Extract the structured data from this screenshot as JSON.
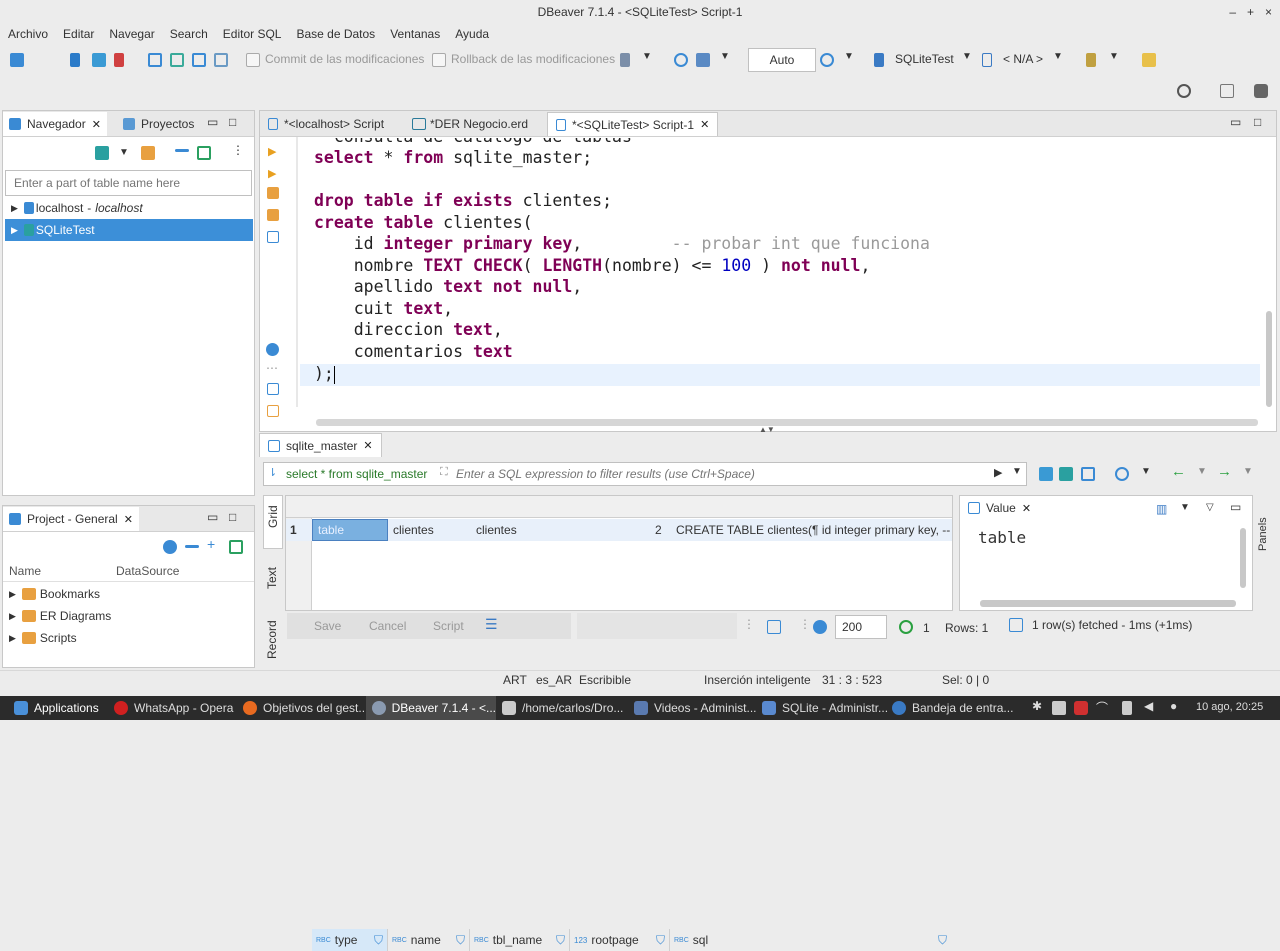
{
  "window": {
    "title": "DBeaver 7.1.4 - <SQLiteTest> Script-1"
  },
  "menu": [
    "Archivo",
    "Editar",
    "Navegar",
    "Search",
    "Editor SQL",
    "Base de Datos",
    "Ventanas",
    "Ayuda"
  ],
  "toolbar": {
    "commit_label": "Commit de las modificaciones",
    "rollback_label": "Rollback de las modificaciones",
    "mode_value": "Auto",
    "datasource": "SQLiteTest",
    "schema": "< N/A >"
  },
  "navigator": {
    "tab_label": "Navegador",
    "projects_tab": "Proyectos",
    "filter_placeholder": "Enter a part of table name here",
    "items": [
      {
        "label": "localhost",
        "sublabel": "localhost"
      },
      {
        "label": "SQLiteTest"
      }
    ]
  },
  "project": {
    "tab_label": "Project - General",
    "col_name": "Name",
    "col_datasource": "DataSource",
    "items": [
      "Bookmarks",
      "ER Diagrams",
      "Scripts"
    ]
  },
  "editor_tabs": [
    "*<localhost> Script",
    "*DER Negocio.erd",
    "*<SQLiteTest> Script-1"
  ],
  "code": {
    "line0": "  consulta de catalogo de tablas",
    "line1_kw1": "select",
    "line1_rest": " * ",
    "line1_kw2": "from",
    "line1_tail": " sqlite_master;",
    "line3_kw": "drop table if exists",
    "line3_tail": " clientes;",
    "line4_kw": "create table",
    "line4_tail": " clientes(",
    "line5_a": "    id ",
    "line5_kw": "integer primary key",
    "line5_b": ",         ",
    "line5_cmt": "-- probar int que funciona",
    "line6_a": "    nombre ",
    "line6_kw": "TEXT CHECK",
    "line6_b": "( ",
    "line6_kw2": "LENGTH",
    "line6_c": "(nombre) <= ",
    "line6_num": "100",
    "line6_d": " ) ",
    "line6_kw3": "not null",
    "line6_e": ",",
    "line7_a": "    apellido ",
    "line7_kw": "text not null",
    "line7_b": ",",
    "line8_a": "    cuit ",
    "line8_kw": "text",
    "line8_b": ",",
    "line9_a": "    direccion ",
    "line9_kw": "text",
    "line9_b": ",",
    "line10_a": "    comentarios ",
    "line10_kw": "text",
    "line11": ");"
  },
  "results": {
    "tab_label": "sqlite_master",
    "query_text": "select * from sqlite_master",
    "filter_placeholder": "Enter a SQL expression to filter results (use Ctrl+Space)",
    "columns": [
      "type",
      "name",
      "tbl_name",
      "rootpage",
      "sql"
    ],
    "column_prefix": [
      "RBC",
      "RBC",
      "RBC",
      "123",
      "RBC"
    ],
    "rows": [
      {
        "num": "1",
        "type": "table",
        "name": "clientes",
        "tbl_name": "clientes",
        "rootpage": "2",
        "sql": "CREATE TABLE clientes(¶ id integer primary key,  -- p"
      }
    ],
    "side_tabs": [
      "Grid",
      "Text",
      "Record"
    ],
    "buttons": {
      "save": "Save",
      "cancel": "Cancel",
      "script": "Script"
    },
    "fetch_size": "200",
    "page": "1",
    "rows_label": "Rows: 1",
    "fetch_status": "1 row(s) fetched - 1ms (+1ms)",
    "value_tab": "Value",
    "value_text": "table",
    "panels_label": "Panels"
  },
  "statusbar": {
    "tz": "ART",
    "locale": "es_AR",
    "mode": "Escribible",
    "insert": "Inserción inteligente",
    "position": "31 : 3 : 523",
    "selection": "Sel: 0 | 0"
  },
  "taskbar": {
    "apps_label": "Applications",
    "items": [
      "WhatsApp - Opera",
      "Objetivos del gest...",
      "DBeaver 7.1.4 - <...",
      "/home/carlos/Dro...",
      "Videos - Administ...",
      "SQLite - Administr...",
      "Bandeja de entra..."
    ],
    "clock": "10 ago, 20:25"
  },
  "colors": {
    "selection": "#3c8fd8",
    "keyword": "#7f0055",
    "taskbar": "#2b2b2b"
  }
}
